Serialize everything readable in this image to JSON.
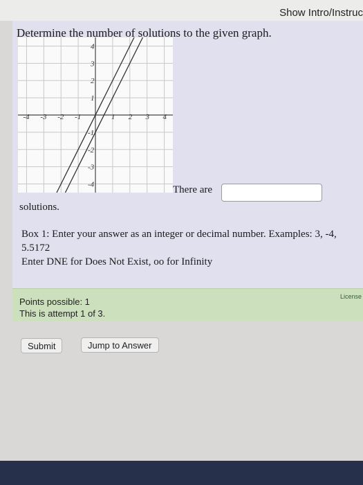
{
  "header": {
    "show_intro_label": "Show Intro/Instruc"
  },
  "question": {
    "prompt": "Determine the number of solutions to the given graph.",
    "there_are_label": "There are",
    "answer_value": "",
    "solutions_label": "solutions.",
    "help_line1": "Box 1: Enter your answer as an integer or decimal number. Examples: 3, -4, 5.5172",
    "help_line2": "Enter DNE for Does Not Exist, oo for Infinity"
  },
  "graph": {
    "x_ticks": [
      "-4",
      "-3",
      "-2",
      "-1",
      "1",
      "2",
      "3",
      "4"
    ],
    "y_ticks": [
      "4",
      "3",
      "2",
      "1",
      "-1",
      "-2",
      "-3",
      "-4"
    ],
    "lines": [
      {
        "slope": 2,
        "intercept": 0
      },
      {
        "slope": 2,
        "intercept": -1
      }
    ]
  },
  "score": {
    "points_label": "Points possible: 1",
    "attempt_label": "This is attempt 1 of 3.",
    "license_label": "License"
  },
  "buttons": {
    "submit_label": "Submit",
    "jump_label": "Jump to Answer"
  }
}
